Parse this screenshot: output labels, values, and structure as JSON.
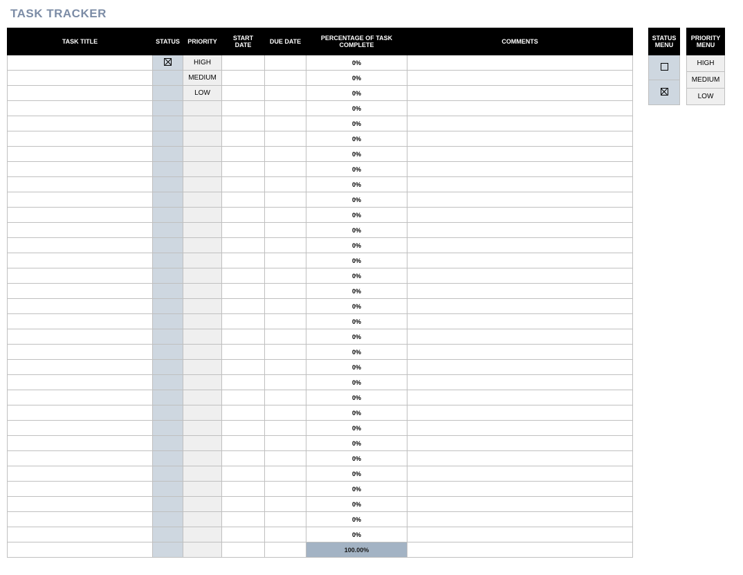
{
  "title": "TASK TRACKER",
  "columns": {
    "task_title": "TASK TITLE",
    "status": "STATUS",
    "priority": "PRIORITY",
    "start_date": "START DATE",
    "due_date": "DUE DATE",
    "pct": "PERCENTAGE OF TASK COMPLETE",
    "comments": "COMMENTS"
  },
  "rows": [
    {
      "title": "",
      "status": "checked",
      "priority": "HIGH",
      "start": "",
      "due": "",
      "pct": "0%",
      "comments": ""
    },
    {
      "title": "",
      "status": "",
      "priority": "MEDIUM",
      "start": "",
      "due": "",
      "pct": "0%",
      "comments": ""
    },
    {
      "title": "",
      "status": "",
      "priority": "LOW",
      "start": "",
      "due": "",
      "pct": "0%",
      "comments": ""
    },
    {
      "title": "",
      "status": "",
      "priority": "",
      "start": "",
      "due": "",
      "pct": "0%",
      "comments": ""
    },
    {
      "title": "",
      "status": "",
      "priority": "",
      "start": "",
      "due": "",
      "pct": "0%",
      "comments": ""
    },
    {
      "title": "",
      "status": "",
      "priority": "",
      "start": "",
      "due": "",
      "pct": "0%",
      "comments": ""
    },
    {
      "title": "",
      "status": "",
      "priority": "",
      "start": "",
      "due": "",
      "pct": "0%",
      "comments": ""
    },
    {
      "title": "",
      "status": "",
      "priority": "",
      "start": "",
      "due": "",
      "pct": "0%",
      "comments": ""
    },
    {
      "title": "",
      "status": "",
      "priority": "",
      "start": "",
      "due": "",
      "pct": "0%",
      "comments": ""
    },
    {
      "title": "",
      "status": "",
      "priority": "",
      "start": "",
      "due": "",
      "pct": "0%",
      "comments": ""
    },
    {
      "title": "",
      "status": "",
      "priority": "",
      "start": "",
      "due": "",
      "pct": "0%",
      "comments": ""
    },
    {
      "title": "",
      "status": "",
      "priority": "",
      "start": "",
      "due": "",
      "pct": "0%",
      "comments": ""
    },
    {
      "title": "",
      "status": "",
      "priority": "",
      "start": "",
      "due": "",
      "pct": "0%",
      "comments": ""
    },
    {
      "title": "",
      "status": "",
      "priority": "",
      "start": "",
      "due": "",
      "pct": "0%",
      "comments": ""
    },
    {
      "title": "",
      "status": "",
      "priority": "",
      "start": "",
      "due": "",
      "pct": "0%",
      "comments": ""
    },
    {
      "title": "",
      "status": "",
      "priority": "",
      "start": "",
      "due": "",
      "pct": "0%",
      "comments": ""
    },
    {
      "title": "",
      "status": "",
      "priority": "",
      "start": "",
      "due": "",
      "pct": "0%",
      "comments": ""
    },
    {
      "title": "",
      "status": "",
      "priority": "",
      "start": "",
      "due": "",
      "pct": "0%",
      "comments": ""
    },
    {
      "title": "",
      "status": "",
      "priority": "",
      "start": "",
      "due": "",
      "pct": "0%",
      "comments": ""
    },
    {
      "title": "",
      "status": "",
      "priority": "",
      "start": "",
      "due": "",
      "pct": "0%",
      "comments": ""
    },
    {
      "title": "",
      "status": "",
      "priority": "",
      "start": "",
      "due": "",
      "pct": "0%",
      "comments": ""
    },
    {
      "title": "",
      "status": "",
      "priority": "",
      "start": "",
      "due": "",
      "pct": "0%",
      "comments": ""
    },
    {
      "title": "",
      "status": "",
      "priority": "",
      "start": "",
      "due": "",
      "pct": "0%",
      "comments": ""
    },
    {
      "title": "",
      "status": "",
      "priority": "",
      "start": "",
      "due": "",
      "pct": "0%",
      "comments": ""
    },
    {
      "title": "",
      "status": "",
      "priority": "",
      "start": "",
      "due": "",
      "pct": "0%",
      "comments": ""
    },
    {
      "title": "",
      "status": "",
      "priority": "",
      "start": "",
      "due": "",
      "pct": "0%",
      "comments": ""
    },
    {
      "title": "",
      "status": "",
      "priority": "",
      "start": "",
      "due": "",
      "pct": "0%",
      "comments": ""
    },
    {
      "title": "",
      "status": "",
      "priority": "",
      "start": "",
      "due": "",
      "pct": "0%",
      "comments": ""
    },
    {
      "title": "",
      "status": "",
      "priority": "",
      "start": "",
      "due": "",
      "pct": "0%",
      "comments": ""
    },
    {
      "title": "",
      "status": "",
      "priority": "",
      "start": "",
      "due": "",
      "pct": "0%",
      "comments": ""
    },
    {
      "title": "",
      "status": "",
      "priority": "",
      "start": "",
      "due": "",
      "pct": "0%",
      "comments": ""
    },
    {
      "title": "",
      "status": "",
      "priority": "",
      "start": "",
      "due": "",
      "pct": "0%",
      "comments": ""
    }
  ],
  "total_pct": "100.00%",
  "status_menu": {
    "header": "STATUS MENU",
    "items": [
      "unchecked",
      "checked"
    ]
  },
  "priority_menu": {
    "header": "PRIORITY MENU",
    "items": [
      "HIGH",
      "MEDIUM",
      "LOW"
    ]
  }
}
